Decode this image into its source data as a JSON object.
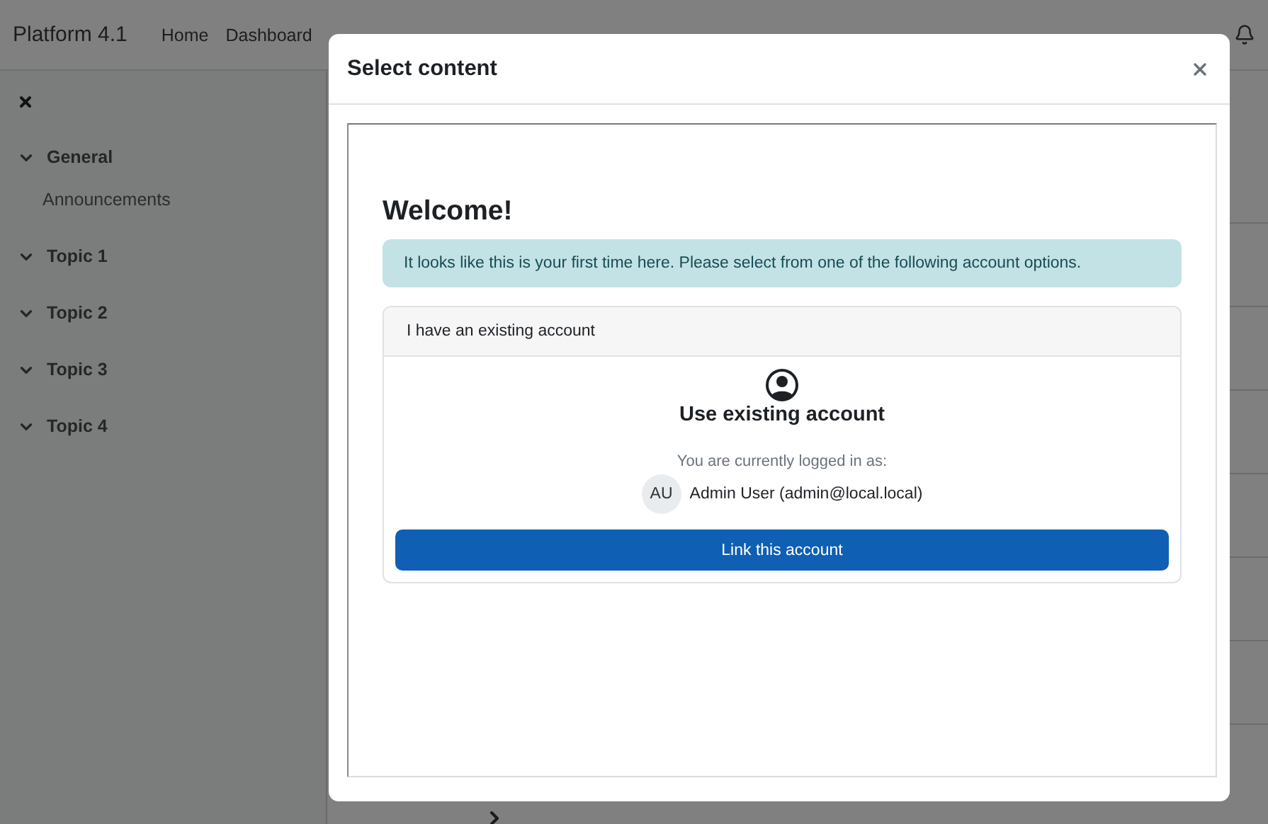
{
  "navbar": {
    "brand": "Platform 4.1",
    "links": [
      "Home",
      "Dashboard"
    ]
  },
  "drawer": {
    "sections": [
      {
        "title": "General",
        "expanded": true,
        "children": [
          {
            "label": "Announcements"
          }
        ]
      },
      {
        "title": "Topic 1",
        "expanded": true
      },
      {
        "title": "Topic 2",
        "expanded": true
      },
      {
        "title": "Topic 3",
        "expanded": true
      },
      {
        "title": "Topic 4",
        "expanded": true
      }
    ]
  },
  "modal": {
    "title": "Select content",
    "content": {
      "heading": "Welcome!",
      "alert": "It looks like this is your first time here. Please select from one of the following account options.",
      "card": {
        "header": "I have an existing account",
        "title": "Use existing account",
        "note": "You are currently logged in as:",
        "user": {
          "initials": "AU",
          "name": "Admin User (admin@local.local)"
        },
        "button": "Link this account"
      }
    }
  }
}
